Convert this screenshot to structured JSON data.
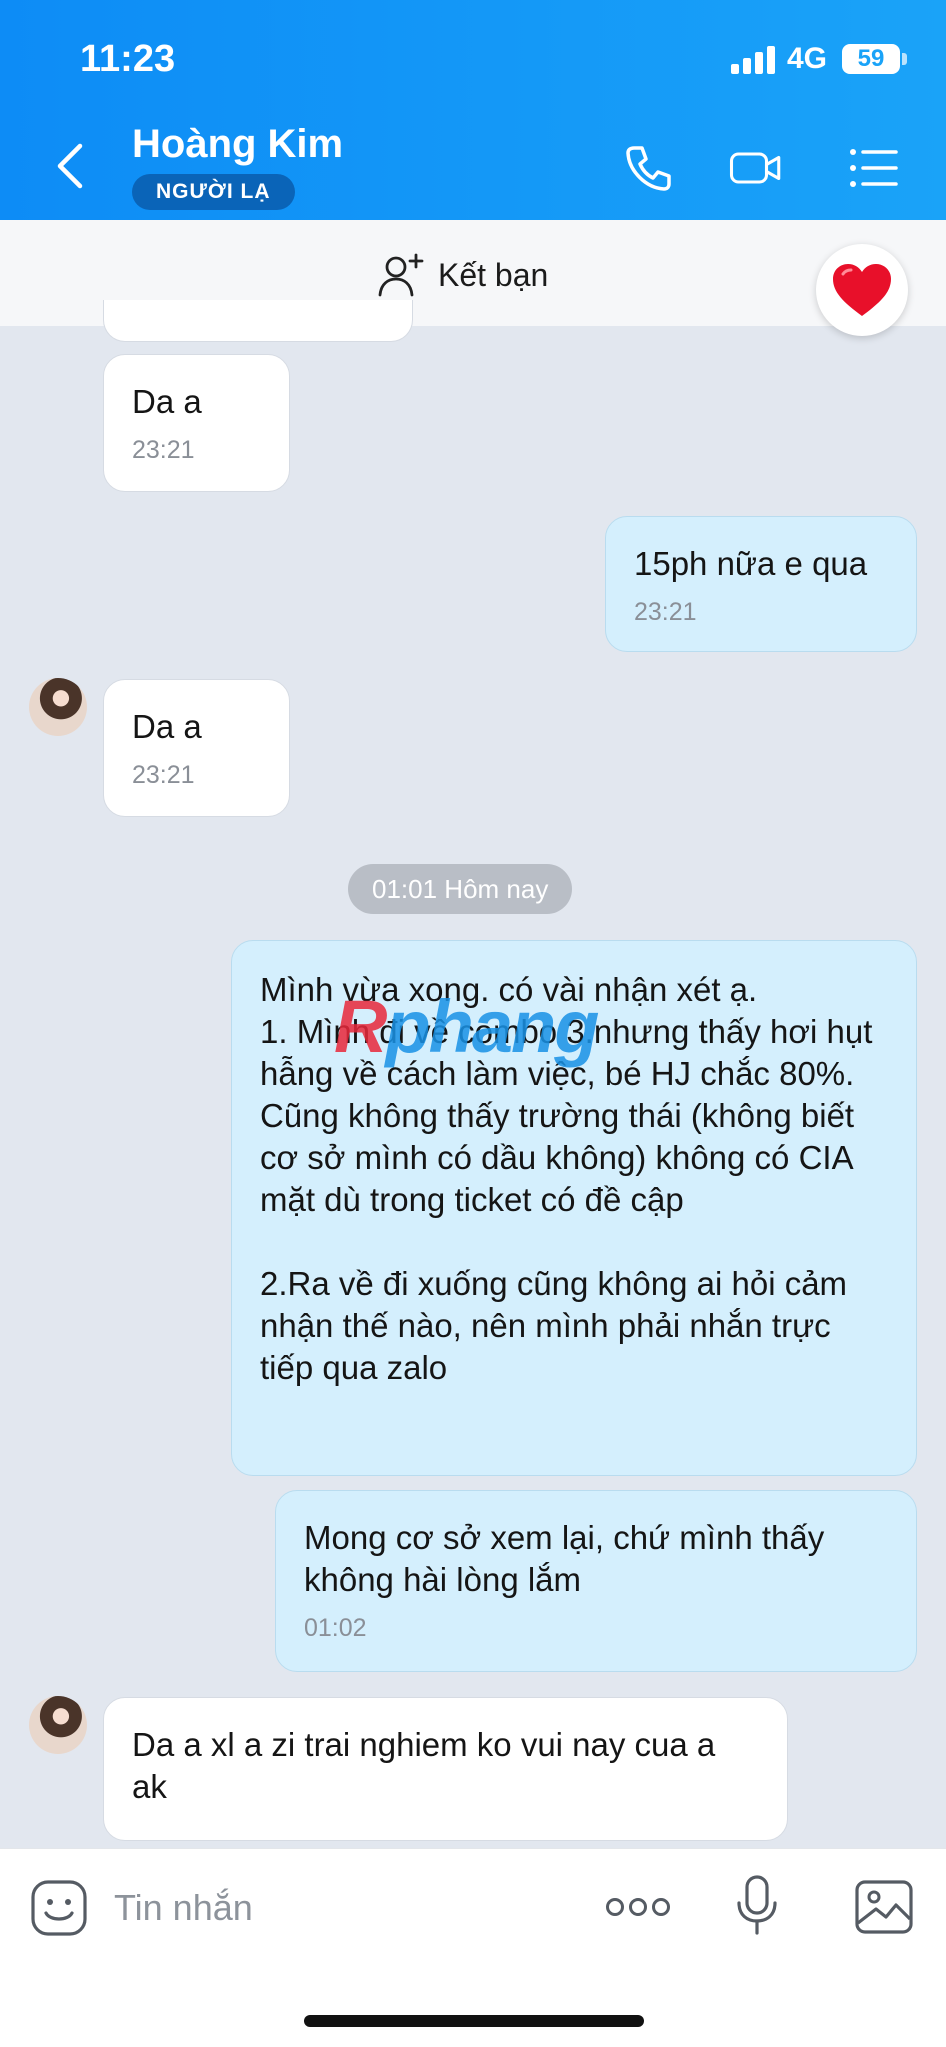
{
  "status_bar": {
    "time": "11:23",
    "network": "4G",
    "battery": "59"
  },
  "header": {
    "contact_name": "Hoàng Kim",
    "badge": "NGƯỜI LẠ"
  },
  "add_friend": {
    "label": "Kết bạn"
  },
  "messages": [
    {
      "direction": "in",
      "text": "Da a",
      "time": "23:21"
    },
    {
      "direction": "out",
      "text": "15ph nữa e qua",
      "time": "23:21"
    },
    {
      "direction": "in",
      "text": "Da a",
      "time": "23:21"
    },
    {
      "direction": "out",
      "text": "Mình vừa xong. có vài nhận xét ạ.\n1. Mình đi về combo 3.nhưng thấy hơi hụt hẫng về cách làm việc, bé HJ chắc 80%. Cũng không thấy trường thái (không biết cơ sở mình có dầu không)  không có CIA mặt dù trong ticket có đề cập\n\n2.Ra về đi xuống cũng không ai hỏi cảm nhận thế nào, nên mình phải nhắn trực tiếp qua zalo",
      "time": ""
    },
    {
      "direction": "out",
      "text": "Mong cơ sở xem lại, chứ mình thấy không hài lòng lắm",
      "time": "01:02"
    },
    {
      "direction": "in",
      "text": "Da a xl a zi trai nghiem ko vui nay cua a ak",
      "time": ""
    }
  ],
  "date_separator": "01:01 Hôm nay",
  "watermark": {
    "part1": "R",
    "part2": "phang"
  },
  "input": {
    "placeholder": "Tin nhắn"
  },
  "colors": {
    "header": "#1aa3f8",
    "outgoing_bubble": "#d4effd",
    "incoming_bubble": "#ffffff",
    "background": "#e2e7ef"
  }
}
